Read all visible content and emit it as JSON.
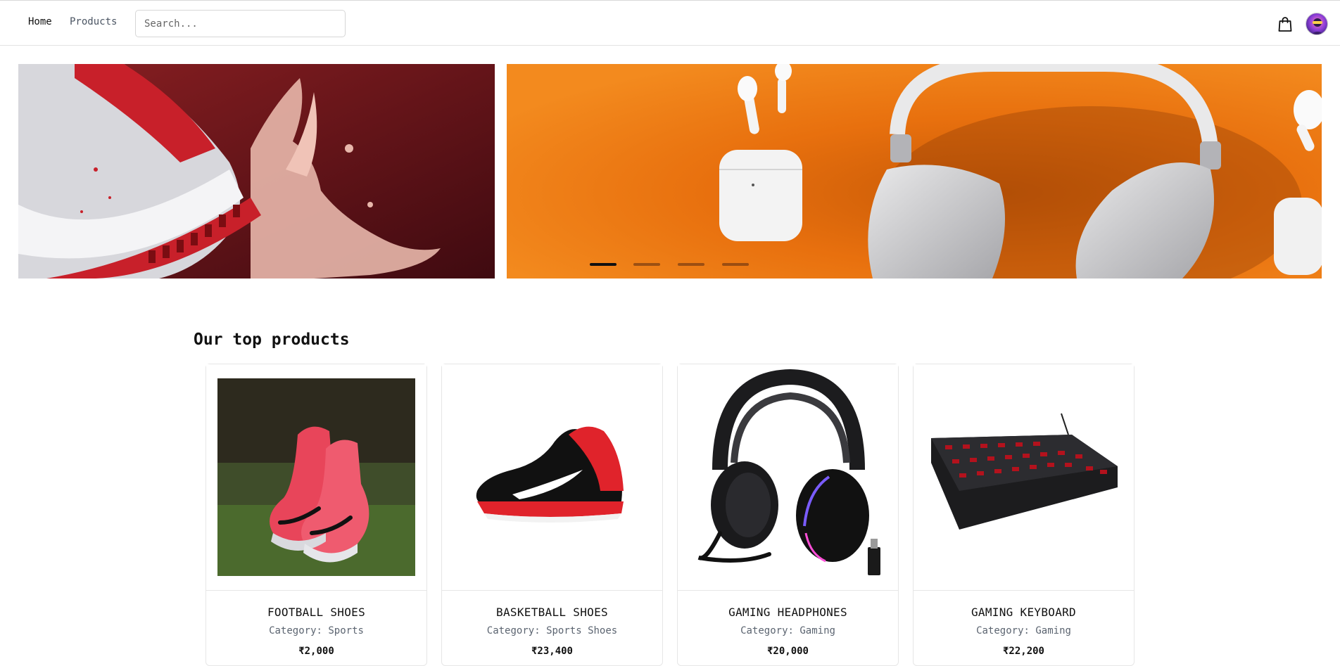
{
  "nav": {
    "home_label": "Home",
    "products_label": "Products",
    "search_placeholder": "Search...",
    "search_value": "",
    "cart_icon": "shopping-bag-icon",
    "avatar_icon": "user-avatar"
  },
  "carousel": {
    "slides": [
      {
        "name": "red-sneaker-splash-banner",
        "color": "#7a1a1d"
      },
      {
        "name": "airpods-headphones-orange-banner",
        "color": "#e8700e"
      }
    ],
    "indicators": [
      {
        "active": true
      },
      {
        "active": false
      },
      {
        "active": false
      },
      {
        "active": false
      }
    ]
  },
  "section": {
    "title": "Our top products"
  },
  "products": [
    {
      "name": "FOOTBALL SHOES",
      "category_label": "Category:",
      "category": "Sports",
      "price": "₹2,000"
    },
    {
      "name": "BASKETBALL SHOES",
      "category_label": "Category:",
      "category": "Sports Shoes",
      "price": "₹23,400"
    },
    {
      "name": "GAMING HEADPHONES",
      "category_label": "Category:",
      "category": "Gaming",
      "price": "₹20,000"
    },
    {
      "name": "GAMING KEYBOARD",
      "category_label": "Category:",
      "category": "Gaming",
      "price": "₹22,200"
    }
  ]
}
